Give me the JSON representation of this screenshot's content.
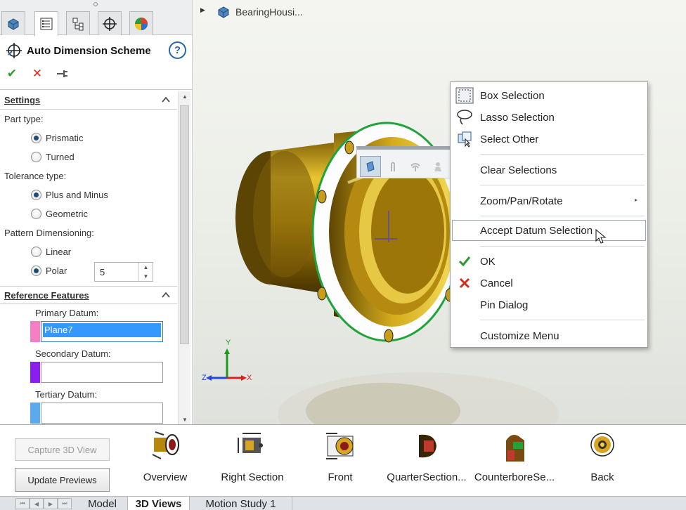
{
  "tabs": [
    {
      "icon": "part-icon"
    },
    {
      "icon": "property-manager-icon"
    },
    {
      "icon": "configuration-manager-icon"
    },
    {
      "icon": "dimxpert-icon"
    },
    {
      "icon": "display-manager-icon"
    }
  ],
  "property_manager": {
    "title": "Auto Dimension Scheme",
    "help": "?",
    "actions": [
      {
        "name": "ok",
        "glyph": "✔",
        "color": "#2e9a2e"
      },
      {
        "name": "cancel",
        "glyph": "✕",
        "color": "#d62b1f"
      },
      {
        "name": "pin",
        "glyph": "⊣",
        "color": "#555555"
      }
    ]
  },
  "settings": {
    "heading": "Settings",
    "part_type_label": "Part type:",
    "part_type_options": [
      "Prismatic",
      "Turned"
    ],
    "part_type_selected": "Prismatic",
    "tolerance_label": "Tolerance type:",
    "tolerance_options": [
      "Plus and Minus",
      "Geometric"
    ],
    "tolerance_selected": "Plus and Minus",
    "pattern_label": "Pattern Dimensioning:",
    "pattern_options": [
      "Linear",
      "Polar"
    ],
    "pattern_selected": "Polar",
    "polar_value": "5"
  },
  "reference": {
    "heading": "Reference Features",
    "primary_label": "Primary Datum:",
    "primary_value": "Plane7",
    "primary_color": "#f57fc3",
    "secondary_label": "Secondary Datum:",
    "secondary_value": "",
    "secondary_color": "#8a1ef0",
    "tertiary_label": "Tertiary Datum:",
    "tertiary_value": "",
    "tertiary_color": "#5ba9f0"
  },
  "viewport": {
    "breadcrumb": "BearingHousi...",
    "triad": {
      "x": "X",
      "y": "Y",
      "z": "Z"
    }
  },
  "context_menu": {
    "items": [
      {
        "label": "Box Selection",
        "icon": "box-selection-icon"
      },
      {
        "label": "Lasso Selection",
        "icon": "lasso-selection-icon"
      },
      {
        "label": "Select Other",
        "icon": "select-other-icon"
      },
      {
        "label": "Clear Selections"
      },
      {
        "label": "Zoom/Pan/Rotate",
        "submenu": "▸"
      },
      {
        "label": "Accept Datum Selection"
      },
      {
        "label": "OK",
        "icon": "check-icon"
      },
      {
        "label": "Cancel",
        "icon": "cancel-icon"
      },
      {
        "label": "Pin Dialog"
      },
      {
        "label": "Customize Menu"
      }
    ]
  },
  "views_panel": {
    "capture_label": "Capture 3D View",
    "update_label": "Update Previews",
    "views": [
      "Overview",
      "Right Section",
      "Front",
      "QuarterSection...",
      "CounterboreSe...",
      "Back"
    ]
  },
  "bottom_tabs": [
    "Model",
    "3D Views",
    "Motion Study 1"
  ],
  "bottom_tabs_active": "3D Views"
}
